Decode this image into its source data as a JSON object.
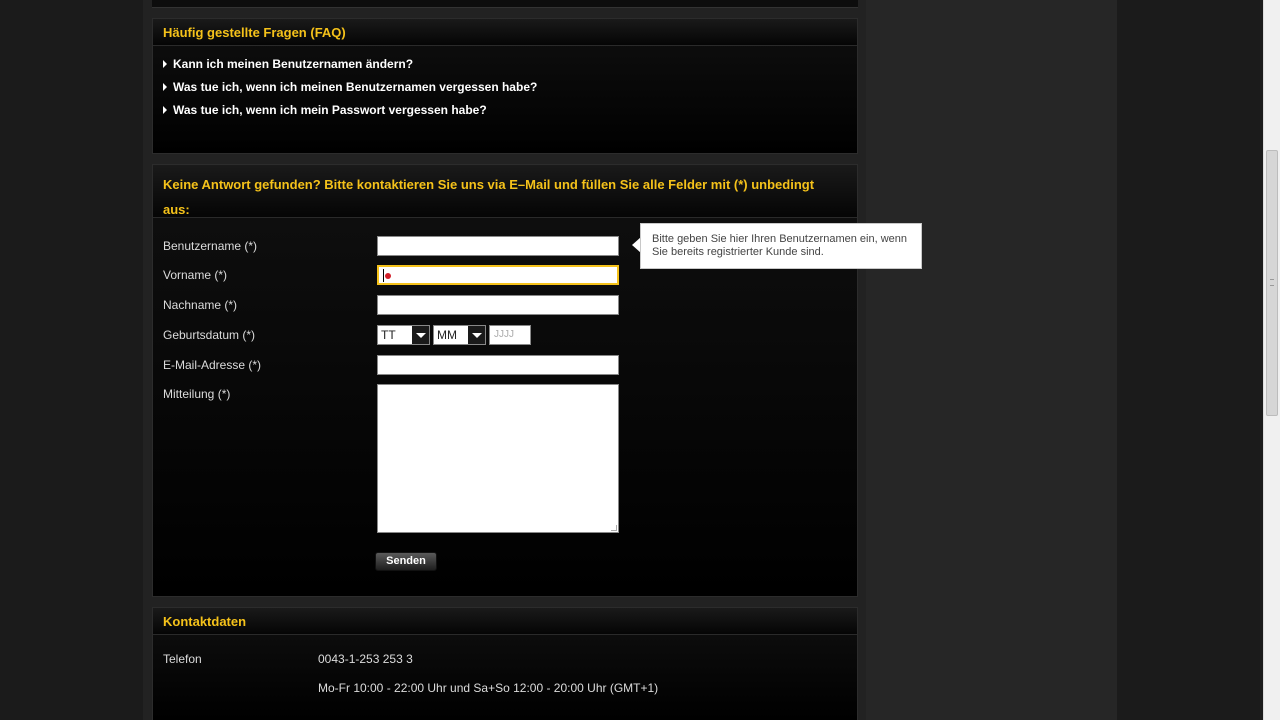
{
  "faq": {
    "title": "Häufig gestellte Fragen (FAQ)",
    "items": [
      "Kann ich meinen Benutzernamen ändern?",
      "Was tue ich, wenn ich meinen Benutzernamen vergessen habe?",
      "Was tue ich, wenn ich mein Passwort vergessen habe?"
    ]
  },
  "contact_form": {
    "title": "Keine Antwort gefunden? Bitte kontaktieren Sie uns via E–Mail und füllen Sie alle Felder mit (*) unbedingt aus:",
    "fields": {
      "username_label": "Benutzername (*)",
      "firstname_label": "Vorname (*)",
      "lastname_label": "Nachname (*)",
      "birthdate_label": "Geburtsdatum (*)",
      "email_label": "E-Mail-Adresse (*)",
      "message_label": "Mitteilung (*)"
    },
    "birthdate": {
      "day_selected": "TT",
      "month_selected": "MM",
      "year_placeholder": "JJJJ"
    },
    "submit_label": "Senden",
    "tooltip": "Bitte geben Sie hier Ihren Benutzernamen ein, wenn Sie bereits registrierter Kunde sind."
  },
  "contact_data": {
    "title": "Kontaktdaten",
    "phone_label": "Telefon",
    "phone_value": "0043-1-253 253 3",
    "hours": "Mo-Fr 10:00 - 22:00 Uhr und Sa+So 12:00 - 20:00 Uhr (GMT+1)"
  },
  "colors": {
    "accent": "#f5c21a",
    "panel_bg": "#000000",
    "page_bg": "#1b1b1b"
  }
}
